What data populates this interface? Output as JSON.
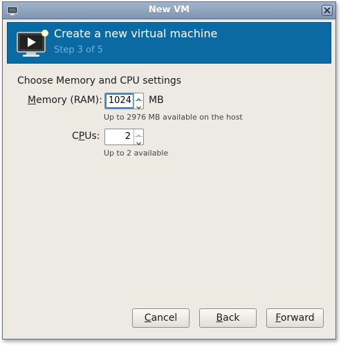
{
  "window": {
    "title": "New VM"
  },
  "header": {
    "title": "Create a new virtual machine",
    "step": "Step 3 of 5",
    "icon": "monitor-play-icon"
  },
  "form": {
    "heading": "Choose Memory and CPU settings",
    "memory": {
      "label_pre": "",
      "label_mnemonic": "M",
      "label_post": "emory (RAM):",
      "value": "1024",
      "unit": "MB",
      "hint": "Up to 2976 MB available on the host"
    },
    "cpus": {
      "label_pre": "C",
      "label_mnemonic": "P",
      "label_post": "Us:",
      "value": "2",
      "hint": "Up to 2 available"
    }
  },
  "buttons": {
    "cancel": {
      "mnemonic": "C",
      "rest": "ancel"
    },
    "back": {
      "mnemonic": "B",
      "rest": "ack"
    },
    "forward": {
      "mnemonic": "F",
      "rest": "orward"
    }
  },
  "colors": {
    "header_bg": "#0b6aa2",
    "step_text": "#6ab2e6",
    "window_bg": "#edeae4"
  }
}
